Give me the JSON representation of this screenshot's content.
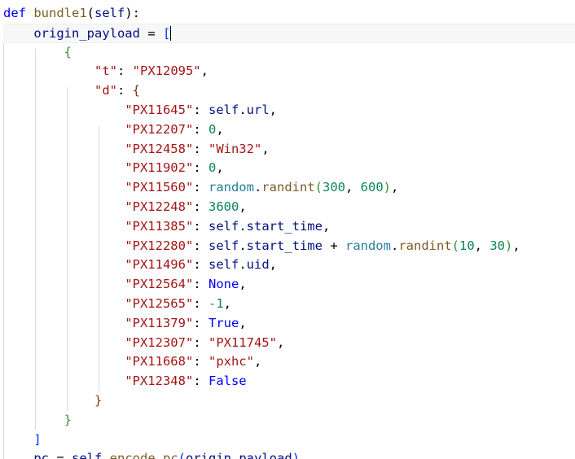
{
  "editor": {
    "lines": [
      [
        {
          "t": "def",
          "c": "kw"
        },
        {
          "t": " ",
          "c": "op"
        },
        {
          "t": "bundle1",
          "c": "fn"
        },
        {
          "t": "(",
          "c": "op"
        },
        {
          "t": "self",
          "c": "var"
        },
        {
          "t": "):",
          "c": "op"
        }
      ],
      [
        {
          "t": "    ",
          "c": "op"
        },
        {
          "t": "origin_payload",
          "c": "var"
        },
        {
          "t": " = ",
          "c": "op"
        },
        {
          "t": "[",
          "c": "bp"
        },
        {
          "t": "|",
          "c": "cursor"
        }
      ],
      [
        {
          "t": "        ",
          "c": "op"
        },
        {
          "t": "{",
          "c": "bb"
        }
      ],
      [
        {
          "t": "            ",
          "c": "op"
        },
        {
          "t": "\"t\"",
          "c": "str"
        },
        {
          "t": ": ",
          "c": "op"
        },
        {
          "t": "\"PX12095\"",
          "c": "str"
        },
        {
          "t": ",",
          "c": "op"
        }
      ],
      [
        {
          "t": "            ",
          "c": "op"
        },
        {
          "t": "\"d\"",
          "c": "str"
        },
        {
          "t": ": ",
          "c": "op"
        },
        {
          "t": "{",
          "c": "bc"
        }
      ],
      [
        {
          "t": "                ",
          "c": "op"
        },
        {
          "t": "\"PX11645\"",
          "c": "str"
        },
        {
          "t": ": ",
          "c": "op"
        },
        {
          "t": "self",
          "c": "var"
        },
        {
          "t": ".",
          "c": "op"
        },
        {
          "t": "url",
          "c": "var"
        },
        {
          "t": ",",
          "c": "op"
        }
      ],
      [
        {
          "t": "                ",
          "c": "op"
        },
        {
          "t": "\"PX12207\"",
          "c": "str"
        },
        {
          "t": ": ",
          "c": "op"
        },
        {
          "t": "0",
          "c": "num"
        },
        {
          "t": ",",
          "c": "op"
        }
      ],
      [
        {
          "t": "                ",
          "c": "op"
        },
        {
          "t": "\"PX12458\"",
          "c": "str"
        },
        {
          "t": ": ",
          "c": "op"
        },
        {
          "t": "\"Win32\"",
          "c": "str"
        },
        {
          "t": ",",
          "c": "op"
        }
      ],
      [
        {
          "t": "                ",
          "c": "op"
        },
        {
          "t": "\"PX11902\"",
          "c": "str"
        },
        {
          "t": ": ",
          "c": "op"
        },
        {
          "t": "0",
          "c": "num"
        },
        {
          "t": ",",
          "c": "op"
        }
      ],
      [
        {
          "t": "                ",
          "c": "op"
        },
        {
          "t": "\"PX11560\"",
          "c": "str"
        },
        {
          "t": ": ",
          "c": "op"
        },
        {
          "t": "random",
          "c": "kw2"
        },
        {
          "t": ".",
          "c": "op"
        },
        {
          "t": "randint",
          "c": "fn"
        },
        {
          "t": "(",
          "c": "bb"
        },
        {
          "t": "300",
          "c": "num"
        },
        {
          "t": ", ",
          "c": "op"
        },
        {
          "t": "600",
          "c": "num"
        },
        {
          "t": ")",
          "c": "bb"
        },
        {
          "t": ",",
          "c": "op"
        }
      ],
      [
        {
          "t": "                ",
          "c": "op"
        },
        {
          "t": "\"PX12248\"",
          "c": "str"
        },
        {
          "t": ": ",
          "c": "op"
        },
        {
          "t": "3600",
          "c": "num"
        },
        {
          "t": ",",
          "c": "op"
        }
      ],
      [
        {
          "t": "                ",
          "c": "op"
        },
        {
          "t": "\"PX11385\"",
          "c": "str"
        },
        {
          "t": ": ",
          "c": "op"
        },
        {
          "t": "self",
          "c": "var"
        },
        {
          "t": ".",
          "c": "op"
        },
        {
          "t": "start_time",
          "c": "var"
        },
        {
          "t": ",",
          "c": "op"
        }
      ],
      [
        {
          "t": "                ",
          "c": "op"
        },
        {
          "t": "\"PX12280\"",
          "c": "str"
        },
        {
          "t": ": ",
          "c": "op"
        },
        {
          "t": "self",
          "c": "var"
        },
        {
          "t": ".",
          "c": "op"
        },
        {
          "t": "start_time",
          "c": "var"
        },
        {
          "t": " + ",
          "c": "op"
        },
        {
          "t": "random",
          "c": "kw2"
        },
        {
          "t": ".",
          "c": "op"
        },
        {
          "t": "randint",
          "c": "fn"
        },
        {
          "t": "(",
          "c": "bb"
        },
        {
          "t": "10",
          "c": "num"
        },
        {
          "t": ", ",
          "c": "op"
        },
        {
          "t": "30",
          "c": "num"
        },
        {
          "t": ")",
          "c": "bb"
        },
        {
          "t": ",",
          "c": "op"
        }
      ],
      [
        {
          "t": "                ",
          "c": "op"
        },
        {
          "t": "\"PX11496\"",
          "c": "str"
        },
        {
          "t": ": ",
          "c": "op"
        },
        {
          "t": "self",
          "c": "var"
        },
        {
          "t": ".",
          "c": "op"
        },
        {
          "t": "uid",
          "c": "var"
        },
        {
          "t": ",",
          "c": "op"
        }
      ],
      [
        {
          "t": "                ",
          "c": "op"
        },
        {
          "t": "\"PX12564\"",
          "c": "str"
        },
        {
          "t": ": ",
          "c": "op"
        },
        {
          "t": "None",
          "c": "kw"
        },
        {
          "t": ",",
          "c": "op"
        }
      ],
      [
        {
          "t": "                ",
          "c": "op"
        },
        {
          "t": "\"PX12565\"",
          "c": "str"
        },
        {
          "t": ": ",
          "c": "op"
        },
        {
          "t": "-1",
          "c": "num"
        },
        {
          "t": ",",
          "c": "op"
        }
      ],
      [
        {
          "t": "                ",
          "c": "op"
        },
        {
          "t": "\"PX11379\"",
          "c": "str"
        },
        {
          "t": ": ",
          "c": "op"
        },
        {
          "t": "True",
          "c": "kw"
        },
        {
          "t": ",",
          "c": "op"
        }
      ],
      [
        {
          "t": "                ",
          "c": "op"
        },
        {
          "t": "\"PX12307\"",
          "c": "str"
        },
        {
          "t": ": ",
          "c": "op"
        },
        {
          "t": "\"PX11745\"",
          "c": "str"
        },
        {
          "t": ",",
          "c": "op"
        }
      ],
      [
        {
          "t": "                ",
          "c": "op"
        },
        {
          "t": "\"PX11668\"",
          "c": "str"
        },
        {
          "t": ": ",
          "c": "op"
        },
        {
          "t": "\"pxhc\"",
          "c": "str"
        },
        {
          "t": ",",
          "c": "op"
        }
      ],
      [
        {
          "t": "                ",
          "c": "op"
        },
        {
          "t": "\"PX12348\"",
          "c": "str"
        },
        {
          "t": ": ",
          "c": "op"
        },
        {
          "t": "False",
          "c": "kw"
        }
      ],
      [
        {
          "t": "            ",
          "c": "op"
        },
        {
          "t": "}",
          "c": "bc"
        }
      ],
      [
        {
          "t": "        ",
          "c": "op"
        },
        {
          "t": "}",
          "c": "bb"
        }
      ],
      [
        {
          "t": "    ",
          "c": "op"
        },
        {
          "t": "]",
          "c": "bp"
        }
      ],
      [
        {
          "t": "    ",
          "c": "op"
        },
        {
          "t": "pc",
          "c": "var"
        },
        {
          "t": " = ",
          "c": "op"
        },
        {
          "t": "self",
          "c": "var"
        },
        {
          "t": ".",
          "c": "op"
        },
        {
          "t": "encode_pc",
          "c": "fn"
        },
        {
          "t": "(",
          "c": "bp"
        },
        {
          "t": "origin_payload",
          "c": "var"
        },
        {
          "t": ")",
          "c": "bp"
        }
      ]
    ]
  }
}
